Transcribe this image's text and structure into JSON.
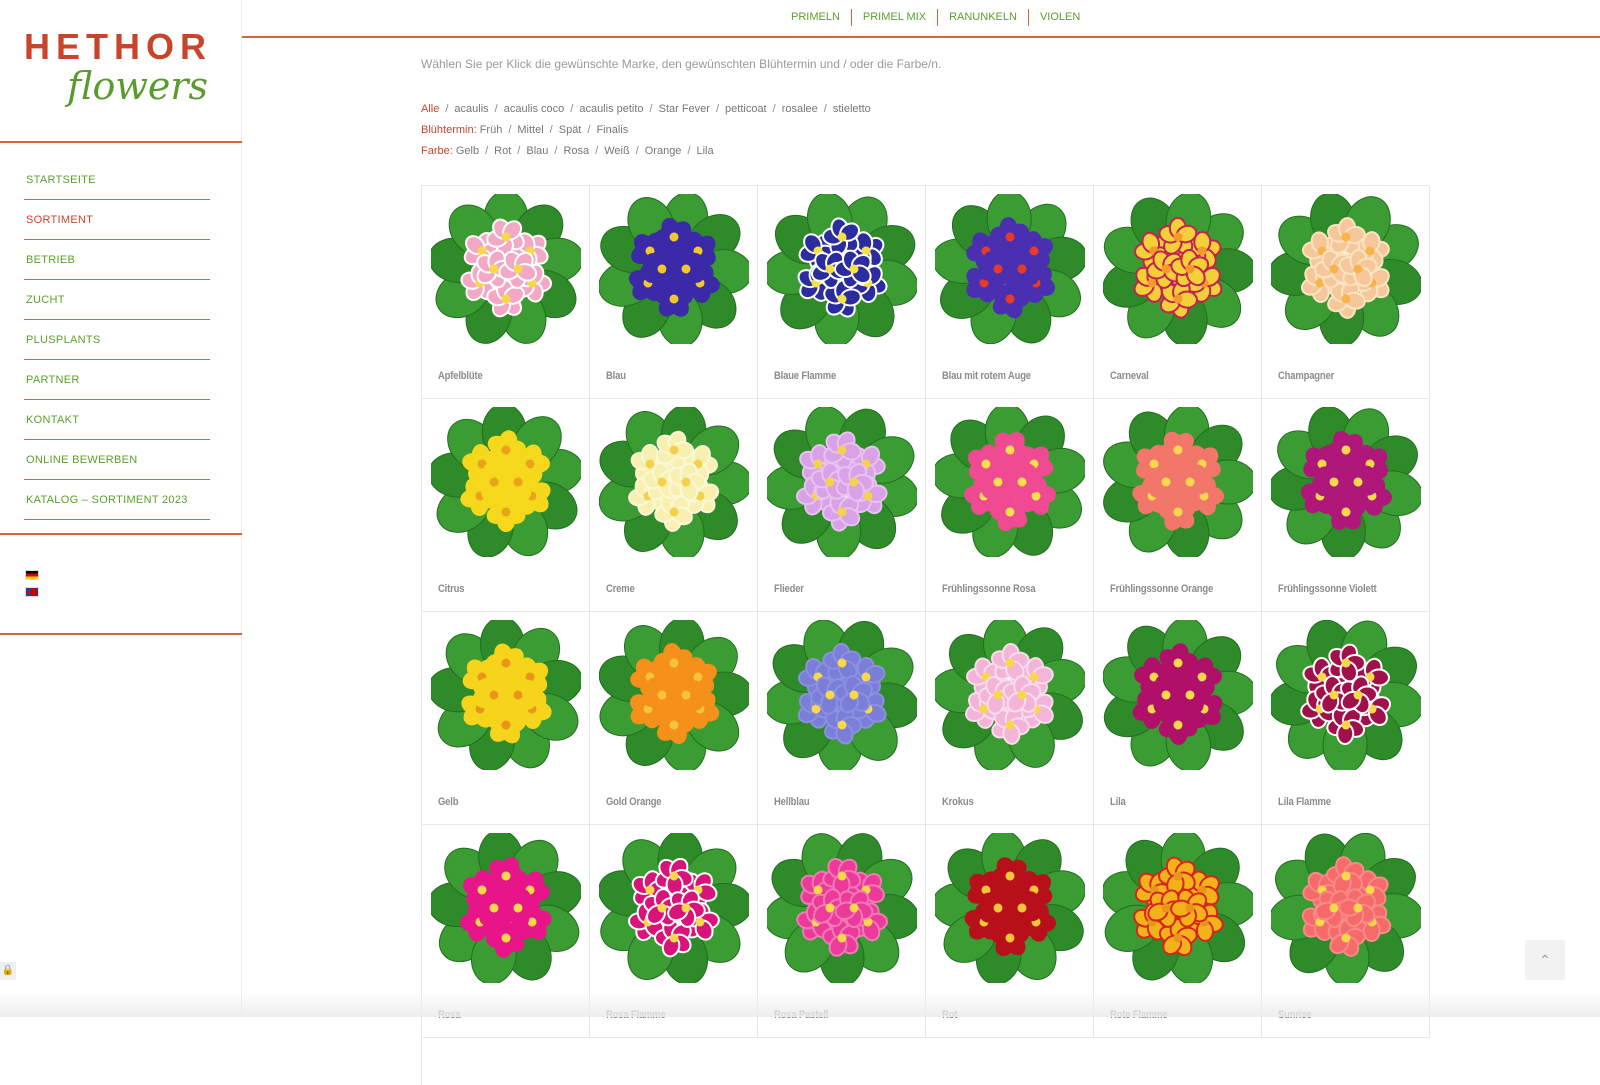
{
  "logo": {
    "brand": "HETHOR",
    "sub": "flowers"
  },
  "nav": {
    "items": [
      {
        "label": "STARTSEITE",
        "active": false
      },
      {
        "label": "SORTIMENT",
        "active": true
      },
      {
        "label": "BETRIEB",
        "active": false
      },
      {
        "label": "ZUCHT",
        "active": false
      },
      {
        "label": "PLUSPLANTS",
        "active": false
      },
      {
        "label": "PARTNER",
        "active": false
      },
      {
        "label": "KONTAKT",
        "active": false
      },
      {
        "label": "ONLINE BEWERBEN",
        "active": false
      },
      {
        "label": "KATALOG – SORTIMENT 2023",
        "active": false
      }
    ]
  },
  "topnav": {
    "items": [
      "PRIMELN",
      "PRIMEL MIX",
      "RANUNKELN",
      "VIOLEN"
    ]
  },
  "intro": "Wählen Sie per Klick die gewünschte Marke, den gewünschten Blühtermin und / oder die Farbe/n.",
  "filters": {
    "brand": {
      "label": "",
      "options": [
        "Alle",
        "acaulis",
        "acaulis coco",
        "acaulis petito",
        "Star Fever",
        "petticoat",
        "rosalee",
        "stieletto"
      ],
      "selected": "Alle"
    },
    "bloom": {
      "label": "Blühtermin:",
      "options": [
        "Früh",
        "Mittel",
        "Spät",
        "Finalis"
      ]
    },
    "color": {
      "label": "Farbe:",
      "options": [
        "Gelb",
        "Rot",
        "Blau",
        "Rosa",
        "Weiß",
        "Orange",
        "Lila"
      ]
    }
  },
  "products": [
    {
      "name": "Apfelblüte",
      "petal": "#f3a9c6",
      "center": "#f6d84a",
      "edge": "#ffffff"
    },
    {
      "name": "Blau",
      "petal": "#3a2aa8",
      "center": "#f2c62e",
      "edge": "#3a2aa8"
    },
    {
      "name": "Blaue Flamme",
      "petal": "#2b2d9e",
      "center": "#f3e14a",
      "edge": "#ffffff"
    },
    {
      "name": "Blau mit rotem Auge",
      "petal": "#4a2fb0",
      "center": "#e83a2a",
      "edge": "#4a2fb0"
    },
    {
      "name": "Carneval",
      "petal": "#f3cf3a",
      "center": "#f39a2a",
      "edge": "#c42250"
    },
    {
      "name": "Champagner",
      "petal": "#f5c79a",
      "center": "#f6b44a",
      "edge": "#fbe4c2"
    },
    {
      "name": "Citrus",
      "petal": "#f5d81c",
      "center": "#e8a51a",
      "edge": "#f5d81c"
    },
    {
      "name": "Creme",
      "petal": "#f7f0b0",
      "center": "#f2d24a",
      "edge": "#fbf7d8"
    },
    {
      "name": "Flieder",
      "petal": "#d9a1e6",
      "center": "#f4d24a",
      "edge": "#e8c2f0"
    },
    {
      "name": "Frühlingssonne Rosa",
      "petal": "#ef4a92",
      "center": "#f6e04a",
      "edge": "#ef4a92"
    },
    {
      "name": "Frühlingssonne Orange",
      "petal": "#f2776a",
      "center": "#f6d84a",
      "edge": "#f2776a"
    },
    {
      "name": "Frühlingssonne Violett",
      "petal": "#b0177a",
      "center": "#f6d84a",
      "edge": "#b0177a"
    },
    {
      "name": "Gelb",
      "petal": "#f7d41c",
      "center": "#e8951a",
      "edge": "#f7d41c"
    },
    {
      "name": "Gold Orange",
      "petal": "#f5901a",
      "center": "#f6c43a",
      "edge": "#f5901a"
    },
    {
      "name": "Hellblau",
      "petal": "#7a7ed8",
      "center": "#f6d84a",
      "edge": "#8c90e0"
    },
    {
      "name": "Krokus",
      "petal": "#f2b4d8",
      "center": "#f6d84a",
      "edge": "#f9dcec"
    },
    {
      "name": "Lila",
      "petal": "#b0106a",
      "center": "#f6d84a",
      "edge": "#b0106a"
    },
    {
      "name": "Lila Flamme",
      "petal": "#a0104a",
      "center": "#f6d84a",
      "edge": "#ffffff"
    },
    {
      "name": "Rosa",
      "petal": "#e8148a",
      "center": "#f6d84a",
      "edge": "#e8148a"
    },
    {
      "name": "Rosa Flamme",
      "petal": "#d8147a",
      "center": "#f6d84a",
      "edge": "#ffffff"
    },
    {
      "name": "Rosa Pastell",
      "petal": "#ec3a9a",
      "center": "#f6d84a",
      "edge": "#f27ab8"
    },
    {
      "name": "Rot",
      "petal": "#b8101a",
      "center": "#f6c43a",
      "edge": "#b8101a"
    },
    {
      "name": "Rote Flamme",
      "petal": "#f3b21a",
      "center": "#e8951a",
      "edge": "#d8241a"
    },
    {
      "name": "Sunrise",
      "petal": "#f66a6a",
      "center": "#f6d84a",
      "edge": "#f88a8a"
    }
  ]
}
